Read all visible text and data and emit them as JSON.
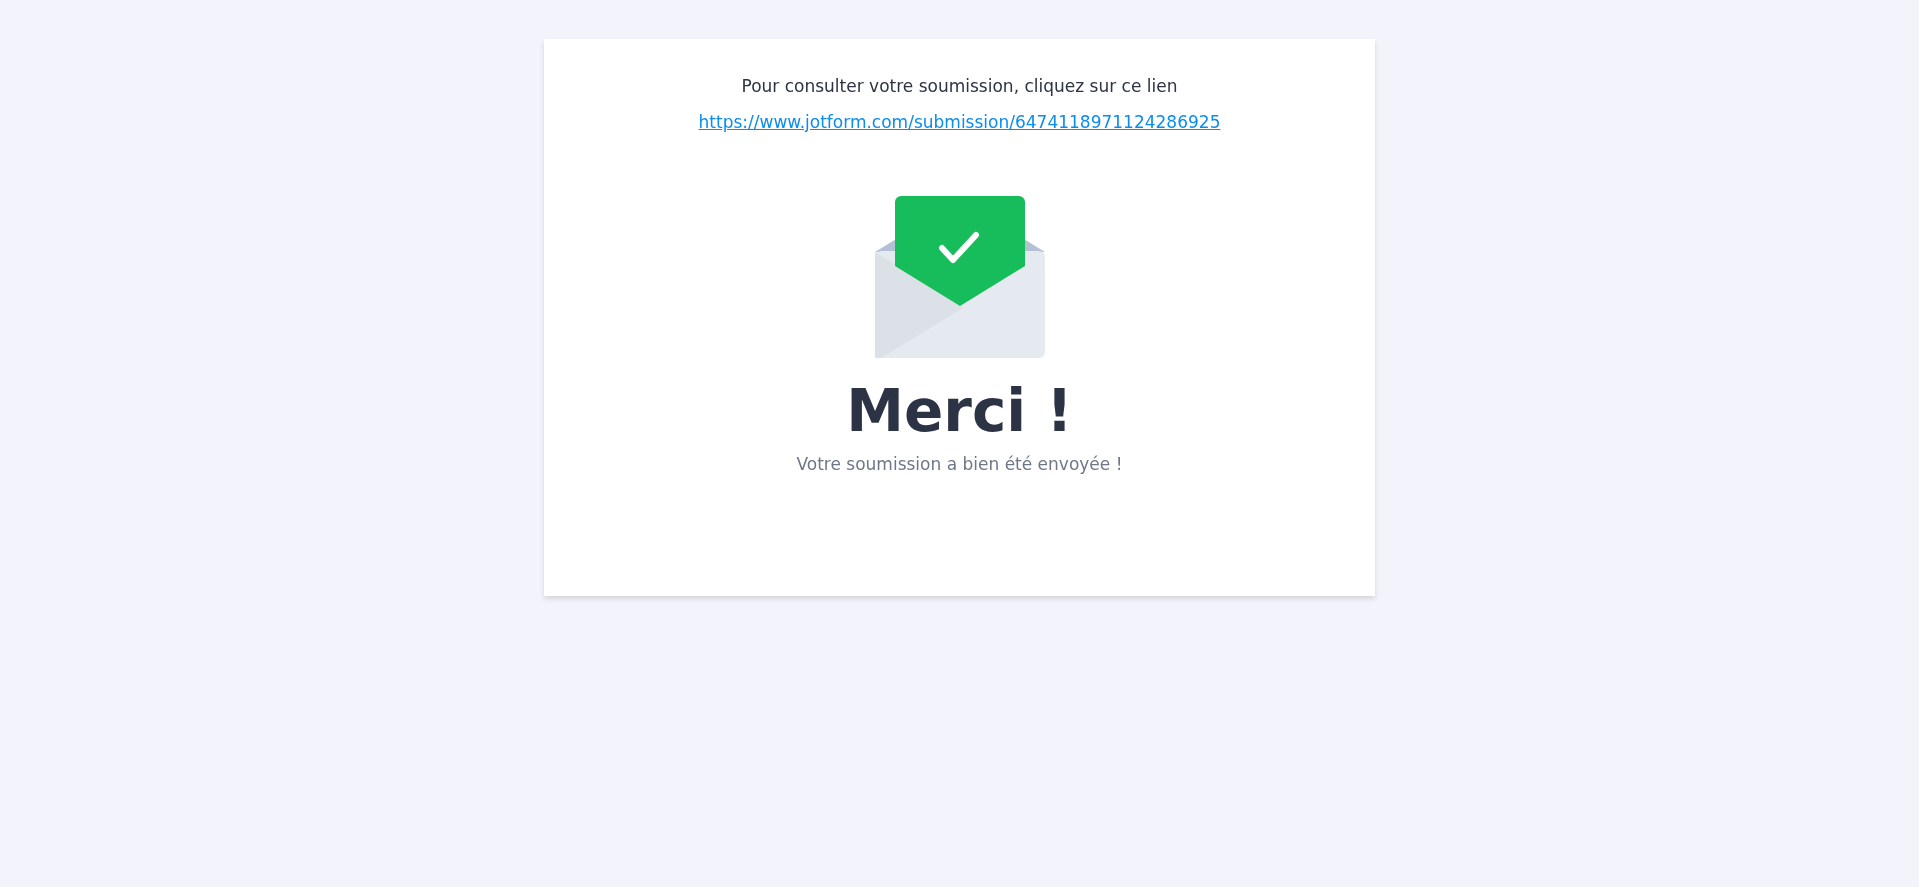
{
  "instruction": "Pour consulter votre soumission, cliquez sur ce lien",
  "link": "https://www.jotform.com/submission/6474118971124286925",
  "heading": "Merci !",
  "message": "Votre soumission a bien été envoyée !"
}
